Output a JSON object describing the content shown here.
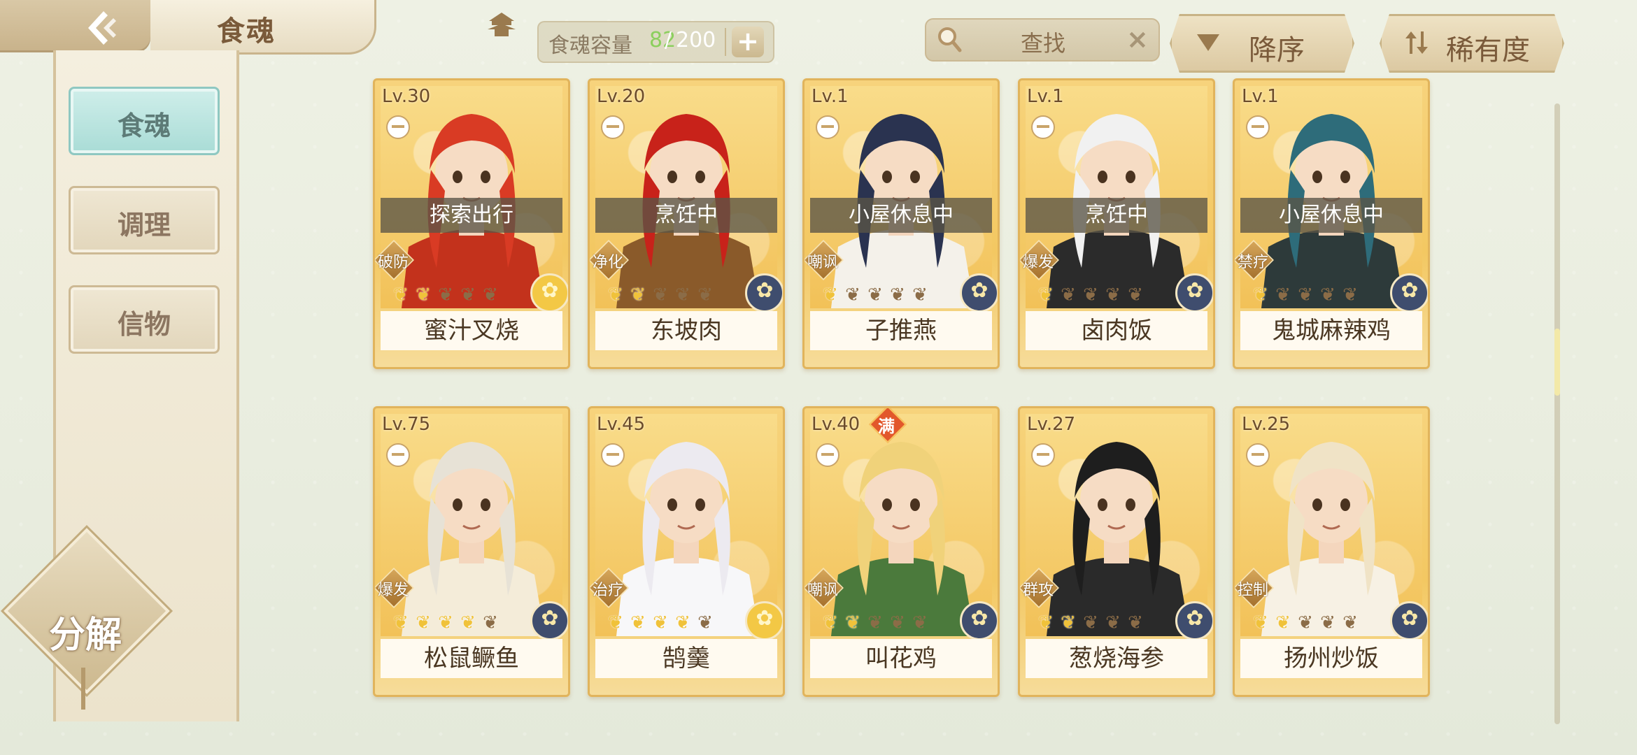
{
  "header": {
    "title": "食魂",
    "capacity_label": "食魂容量",
    "capacity_current": "82",
    "capacity_slash": "/",
    "capacity_max": "200",
    "add_label": "+",
    "search_text": "查找",
    "clear_label": "×",
    "sort_order_label": "降序",
    "sort_rarity_label": "稀有度"
  },
  "sidebar": {
    "tabs": [
      {
        "label": "食魂",
        "active": true
      },
      {
        "label": "调理",
        "active": false
      },
      {
        "label": "信物",
        "active": false
      }
    ],
    "decompose_label": "分解"
  },
  "cards": [
    {
      "level": "Lv.30",
      "status": "探索出行",
      "role": "破防",
      "stars_on": 2,
      "element": "gold",
      "name": "蜜汁叉烧",
      "full": false,
      "hair": "#d93b24",
      "coat": "#c3321c"
    },
    {
      "level": "Lv.20",
      "status": "烹饪中",
      "role": "净化",
      "stars_on": 2,
      "element": "blue",
      "name": "东坡肉",
      "full": false,
      "hair": "#c8221a",
      "coat": "#8a5a2a"
    },
    {
      "level": "Lv.1",
      "status": "小屋休息中",
      "role": "嘲讽",
      "stars_on": 1,
      "element": "blue",
      "name": "子推燕",
      "full": false,
      "hair": "#2a3350",
      "coat": "#f4f1ea"
    },
    {
      "level": "Lv.1",
      "status": "烹饪中",
      "role": "爆发",
      "stars_on": 1,
      "element": "blue",
      "name": "卤肉饭",
      "full": false,
      "hair": "#f1f1f1",
      "coat": "#2b2b2b"
    },
    {
      "level": "Lv.1",
      "status": "小屋休息中",
      "role": "禁疗",
      "stars_on": 1,
      "element": "blue",
      "name": "鬼城麻辣鸡",
      "full": false,
      "hair": "#2e6c7a",
      "coat": "#2d3a3a"
    },
    {
      "level": "Lv.75",
      "status": "",
      "role": "爆发",
      "stars_on": 4,
      "element": "blue",
      "name": "松鼠鳜鱼",
      "full": false,
      "hair": "#e7e2d6",
      "coat": "#f4ecd9"
    },
    {
      "level": "Lv.45",
      "status": "",
      "role": "治疗",
      "stars_on": 4,
      "element": "gold",
      "name": "鹄羹",
      "full": false,
      "hair": "#eceaf0",
      "coat": "#f7f7f9"
    },
    {
      "level": "Lv.40",
      "status": "",
      "role": "嘲讽",
      "stars_on": 2,
      "element": "blue",
      "name": "叫花鸡",
      "full": true,
      "full_label": "满",
      "hair": "#f0d27a",
      "coat": "#4b7a3c"
    },
    {
      "level": "Lv.27",
      "status": "",
      "role": "群攻",
      "stars_on": 2,
      "element": "blue",
      "name": "葱烧海参",
      "full": false,
      "hair": "#1e1e1e",
      "coat": "#2a2a2a"
    },
    {
      "level": "Lv.25",
      "status": "",
      "role": "控制",
      "stars_on": 2,
      "element": "blue",
      "name": "扬州炒饭",
      "full": false,
      "hair": "#f0e3c6",
      "coat": "#f7f1e4"
    }
  ],
  "icons": {
    "back": "back-arrow-icon",
    "home": "pagoda-icon",
    "search": "magnifier-icon",
    "element_gold": "flower-gold-icon",
    "element_blue": "flower-blue-icon"
  },
  "colors": {
    "accent_green": "#8ccf5e",
    "card_gold": "#f3c862",
    "active_tab": "#a9dcd6"
  }
}
